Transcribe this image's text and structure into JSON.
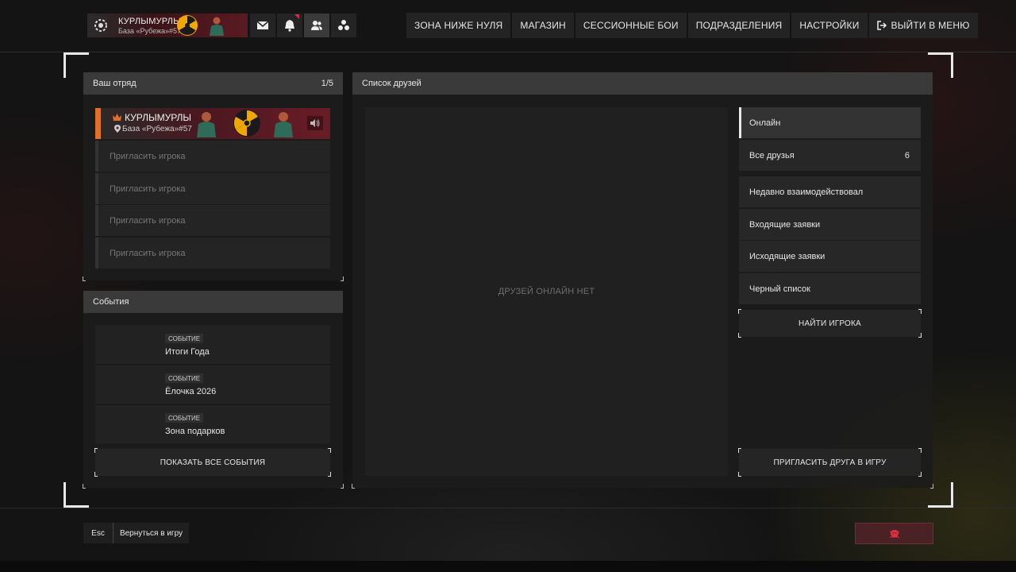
{
  "profile": {
    "name": "КУРЛЫМУРЛЫ",
    "base": "База «Рубежа»#57"
  },
  "top_icons": [
    "mail-icon",
    "bell-icon",
    "friends-icon",
    "squad-icon"
  ],
  "nav": {
    "items": [
      {
        "label": "ЗОНА НИЖЕ НУЛЯ"
      },
      {
        "label": "МАГАЗИН"
      },
      {
        "label": "СЕССИОННЫЕ БОИ"
      },
      {
        "label": "ПОДРАЗДЕЛЕНИЯ"
      },
      {
        "label": "НАСТРОЙКИ"
      },
      {
        "label": "ВЫЙТИ В МЕНЮ"
      }
    ]
  },
  "squad": {
    "title": "Ваш отряд",
    "count": "1/5",
    "leader": {
      "name": "КУРЛЫМУРЛЫ",
      "base": "База «Рубежа»#57"
    },
    "slots": [
      "Пригласить игрока",
      "Пригласить игрока",
      "Пригласить игрока",
      "Пригласить игрока"
    ]
  },
  "events": {
    "title": "События",
    "items": [
      {
        "tag": "СОБЫТИЕ",
        "name": "Итоги Года"
      },
      {
        "tag": "СОБЫТИЕ",
        "name": "Ёлочка 2026"
      },
      {
        "tag": "СОБЫТИЕ",
        "name": "Зона подарков"
      }
    ],
    "show_all": "ПОКАЗАТЬ ВСЕ СОБЫТИЯ"
  },
  "friends": {
    "title": "Список друзей",
    "empty": "ДРУЗЕЙ ОНЛАЙН НЕТ",
    "tabs": [
      {
        "label": "Онлайн",
        "count": ""
      },
      {
        "label": "Все друзья",
        "count": "6"
      },
      {
        "label": "Недавно взаимодействовал",
        "count": ""
      },
      {
        "label": "Входящие заявки",
        "count": ""
      },
      {
        "label": "Исходящие заявки",
        "count": ""
      },
      {
        "label": "Черный список",
        "count": ""
      }
    ],
    "find": "НАЙТИ ИГРОКА",
    "invite": "ПРИГЛАСИТЬ ДРУГА В ИГРУ"
  },
  "footer": {
    "esc_key": "Esc",
    "back": "Вернуться в игру"
  },
  "colors": {
    "accent_orange": "#e0702a",
    "brand_red": "#6a1c26",
    "hazard_yellow": "#f0a800",
    "report_red": "#e03040"
  }
}
